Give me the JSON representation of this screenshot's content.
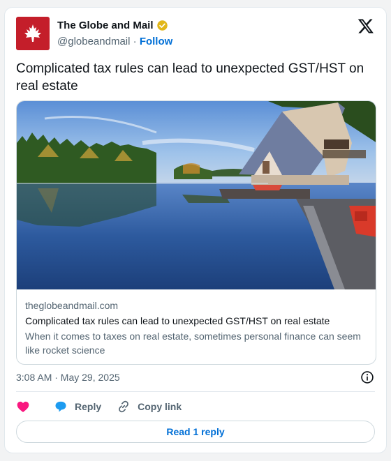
{
  "author": {
    "name": "The Globe and Mail",
    "handle": "@globeandmail",
    "separator": "·",
    "follow_label": "Follow",
    "avatar_icon": "maple-leaf-icon",
    "avatar_color": "#c41e2a",
    "verified_color": "#e2b719"
  },
  "tweet": {
    "text": "Complicated tax rules can lead to unexpected GST/HST on real estate"
  },
  "link_card": {
    "image_alt": "lake-cottage-photo",
    "domain": "theglobeandmail.com",
    "title": "Complicated tax rules can lead to unexpected GST/HST on real estate",
    "description": "When it comes to taxes on real estate, sometimes personal finance can seem like rocket science"
  },
  "meta": {
    "timestamp": "3:08 AM · May 29, 2025"
  },
  "actions": {
    "like_icon": "heart-icon",
    "reply_label": "Reply",
    "copy_label": "Copy link",
    "read_replies_label": "Read 1 reply"
  },
  "colors": {
    "link_blue": "#006fd6",
    "like_pink": "#f91880",
    "reply_blue": "#1d9bf0"
  }
}
